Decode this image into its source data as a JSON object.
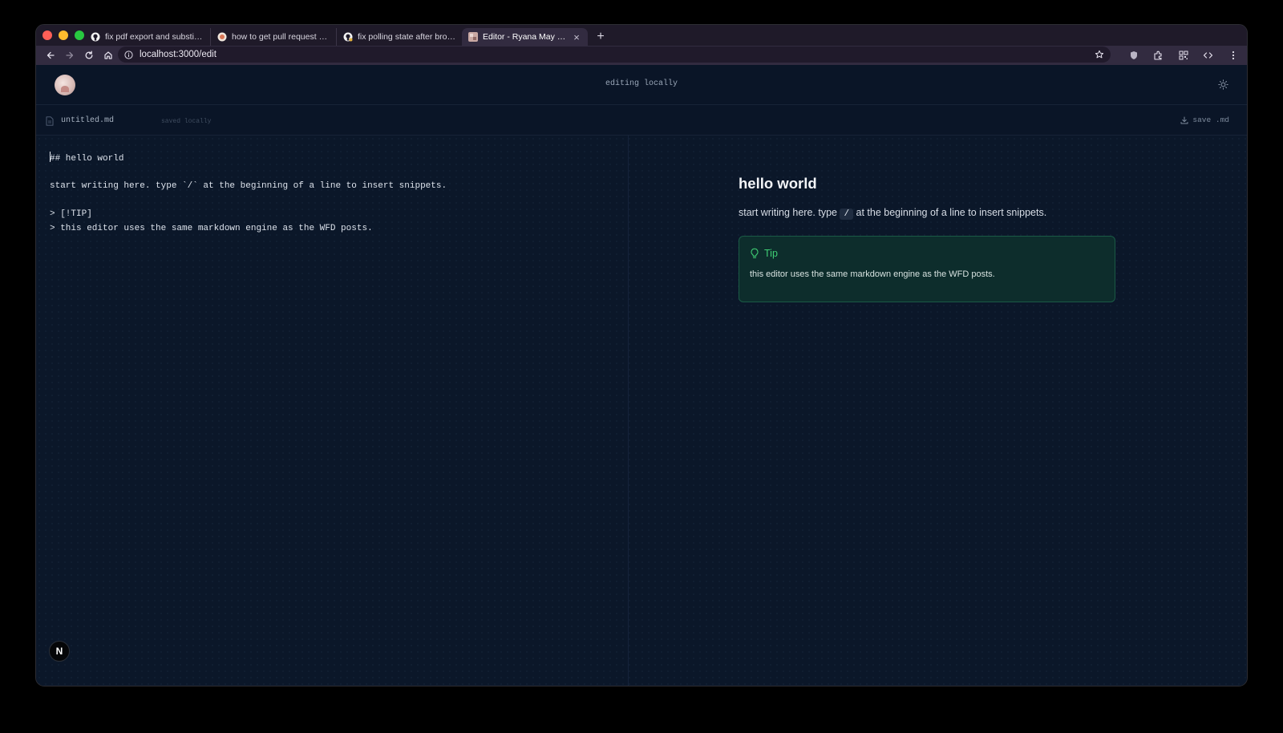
{
  "browser": {
    "tabs": [
      {
        "title": "fix pdf export and substitutio",
        "icon": "github-icon",
        "active": false
      },
      {
        "title": "how to get pull request revie",
        "icon": "ai-assistant-icon",
        "active": false
      },
      {
        "title": "fix polling state after broadc",
        "icon": "github-icon",
        "active": false
      },
      {
        "title": "Editor - Ryana May Que",
        "icon": "site-favicon",
        "active": true
      }
    ],
    "new_tab": "+",
    "tab_close": "×",
    "url": "localhost:3000/edit"
  },
  "header": {
    "title": "editing locally"
  },
  "file": {
    "name": "untitled.md",
    "status": "saved locally",
    "save_label": "save .md"
  },
  "editor": {
    "lines": [
      "## hello world",
      "",
      "start writing here. type `/` at the beginning of a line to insert snippets.",
      "",
      "> [!TIP]",
      "> this editor uses the same markdown engine as the WFD posts."
    ]
  },
  "preview": {
    "heading": "hello world",
    "para_before": "start writing here. type ",
    "para_code": "/",
    "para_after": " at the beginning of a line to insert snippets.",
    "tip_title": "Tip",
    "tip_text": "this editor uses the same markdown engine as the WFD posts."
  },
  "badge": "N",
  "colors": {
    "page_bg": "#0b1729",
    "tip_accent": "#3fce74",
    "tip_bg": "#0d2d2c"
  }
}
